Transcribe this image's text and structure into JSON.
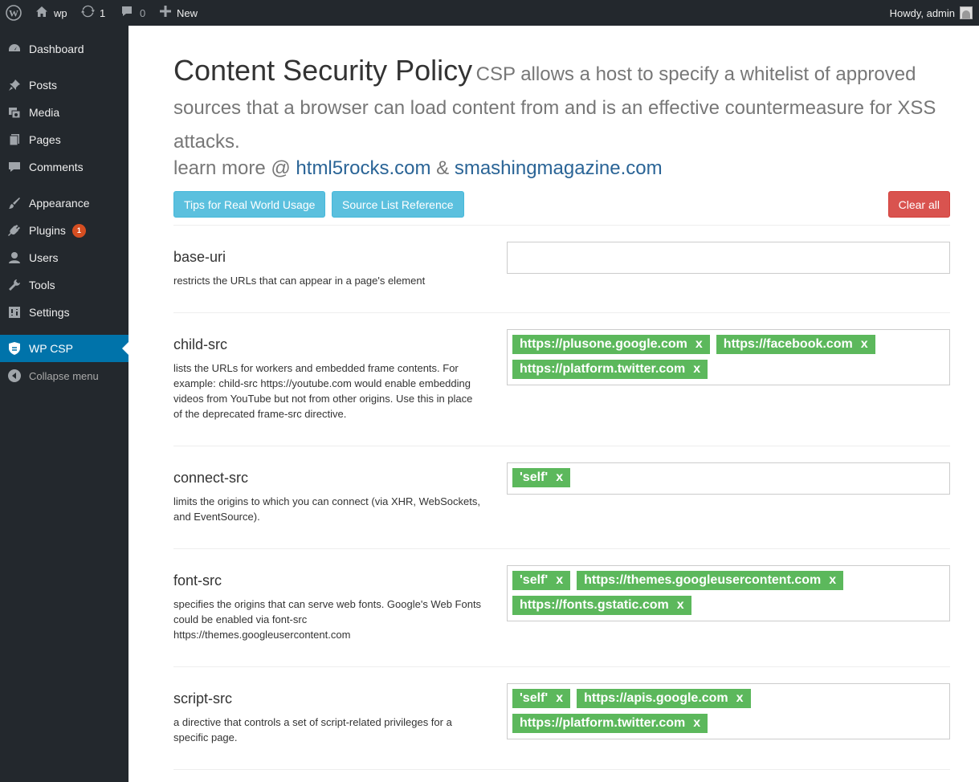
{
  "adminbar": {
    "site_name": "wp",
    "updates_count": "1",
    "comments_count": "0",
    "new_label": "New",
    "howdy": "Howdy, admin"
  },
  "sidebar": {
    "items": [
      {
        "label": "Dashboard",
        "icon": "dashboard-icon"
      },
      {
        "label": "Posts",
        "icon": "pin-icon"
      },
      {
        "label": "Media",
        "icon": "media-icon"
      },
      {
        "label": "Pages",
        "icon": "pages-icon"
      },
      {
        "label": "Comments",
        "icon": "comment-icon"
      },
      {
        "label": "Appearance",
        "icon": "brush-icon"
      },
      {
        "label": "Plugins",
        "icon": "plug-icon",
        "badge": "1"
      },
      {
        "label": "Users",
        "icon": "user-icon"
      },
      {
        "label": "Tools",
        "icon": "wrench-icon"
      },
      {
        "label": "Settings",
        "icon": "settings-icon"
      },
      {
        "label": "WP CSP",
        "icon": "csp-icon",
        "active": true
      },
      {
        "label": "Collapse menu",
        "icon": "collapse-icon"
      }
    ]
  },
  "header": {
    "title": "Content Security Policy",
    "subtitle": "CSP allows a host to specify a whitelist of approved sources that a browser can load content from and is an effective countermeasure for XSS attacks.",
    "learn_prefix": "learn more @",
    "link1": "html5rocks.com",
    "amp": "&",
    "link2": "smashingmagazine.com"
  },
  "buttons": {
    "tips": "Tips for Real World Usage",
    "source": "Source List Reference",
    "clear": "Clear all"
  },
  "directives": [
    {
      "name": "base-uri",
      "desc": "restricts the URLs that can appear in a page's element",
      "tags": []
    },
    {
      "name": "child-src",
      "desc": "lists the URLs for workers and embedded frame contents. For example: child-src https://youtube.com would enable embedding videos from YouTube but not from other origins. Use this in place of the deprecated frame-src directive.",
      "tags": [
        "https://plusone.google.com",
        "https://facebook.com",
        "https://platform.twitter.com"
      ]
    },
    {
      "name": "connect-src",
      "desc": "limits the origins to which you can connect (via XHR, WebSockets, and EventSource).",
      "tags": [
        "'self'"
      ]
    },
    {
      "name": "font-src",
      "desc": "specifies the origins that can serve web fonts. Google's Web Fonts could be enabled via font-src https://themes.googleusercontent.com",
      "tags": [
        "'self'",
        "https://themes.googleusercontent.com",
        "https://fonts.gstatic.com"
      ]
    },
    {
      "name": "script-src",
      "desc": "a directive that controls a set of script-related privileges for a specific page.",
      "tags": [
        "'self'",
        "https://apis.google.com",
        "https://platform.twitter.com"
      ]
    }
  ],
  "tag_remove_label": "x",
  "colors": {
    "adminbar_bg": "#23282d",
    "active_menu": "#0073aa",
    "tag_bg": "#5cb85c",
    "info_btn": "#5bc0de",
    "danger_btn": "#d9534f",
    "link": "#2a6496"
  }
}
